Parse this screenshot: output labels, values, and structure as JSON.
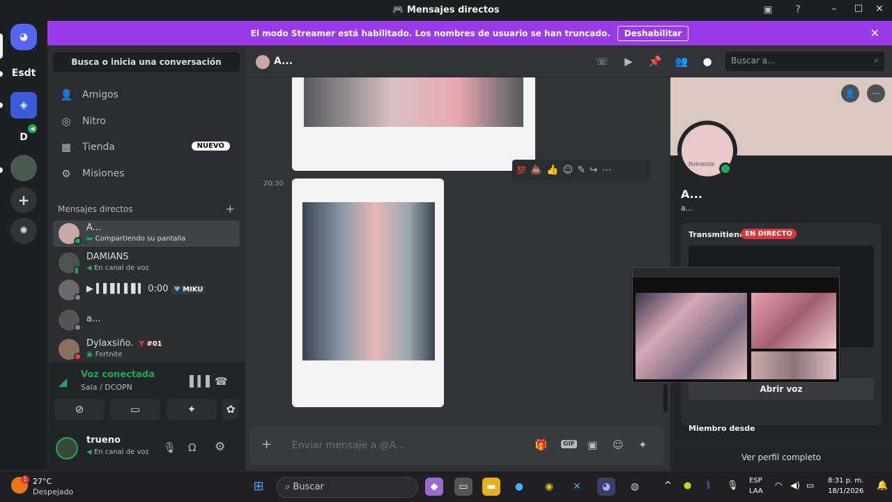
{
  "window": {
    "title": "Mensajes directos"
  },
  "banner": {
    "text": "El modo Streamer está habilitado. Los nombres de usuario se han truncado.",
    "button": "Deshabilitar"
  },
  "guilds": [
    {
      "label": "Esdt"
    },
    {
      "label": "D"
    }
  ],
  "sidebar": {
    "search": "Busca o inicia una conversación",
    "nav": [
      {
        "label": "Amigos",
        "icon": "friends-icon"
      },
      {
        "label": "Nitro",
        "icon": "nitro-icon"
      },
      {
        "label": "Tienda",
        "icon": "shop-icon",
        "badge": "NUEVO"
      },
      {
        "label": "Misiones",
        "icon": "quests-icon"
      }
    ],
    "dm_header": "Mensajes directos",
    "dms": [
      {
        "name": "A...",
        "sub": "Compartiendo su pantalla",
        "status": "online"
      },
      {
        "name": "DAMIANS",
        "sub": "En canal de voz",
        "status": "mobile"
      },
      {
        "name": "",
        "sub": "",
        "status": "offline",
        "voice_time": "0:00",
        "tag": "MIKU"
      },
      {
        "name": "a...",
        "sub": "",
        "status": "offline"
      },
      {
        "name": "Dylaxsiño.",
        "sub": "Fortnite",
        "status": "dnd",
        "tag": "#01"
      }
    ]
  },
  "voice": {
    "status": "Voz conectada",
    "channel": "Sala / DCOPN"
  },
  "user": {
    "name": "trueno",
    "status": "En canal de voz"
  },
  "chat": {
    "recipient": "A...",
    "search_placeholder": "Buscar a...",
    "timestamp": "20:30",
    "input_placeholder": "Enviar mensaje a @A...",
    "gif_label": "GIF"
  },
  "profile": {
    "name": "A...",
    "username": "a...",
    "avatar_caption": "Rokreiste",
    "streaming_label": "Transmitiendo",
    "live_badge": "EN DIRECTO",
    "join_voice": "Abrir voz",
    "member_since": "Miembro desde",
    "view_full": "Ver perfil completo"
  },
  "taskbar": {
    "weather_temp": "27°C",
    "weather_desc": "Despejado",
    "weather_badge": "1",
    "search": "Buscar",
    "lang1": "ESP",
    "lang2": "LAA",
    "time": "8:31 p. m.",
    "date": "18/1/2026"
  },
  "colors": {
    "banner": "#9b3ae9",
    "accent": "#5865f2",
    "green": "#23a55a",
    "live": "#da373c"
  }
}
